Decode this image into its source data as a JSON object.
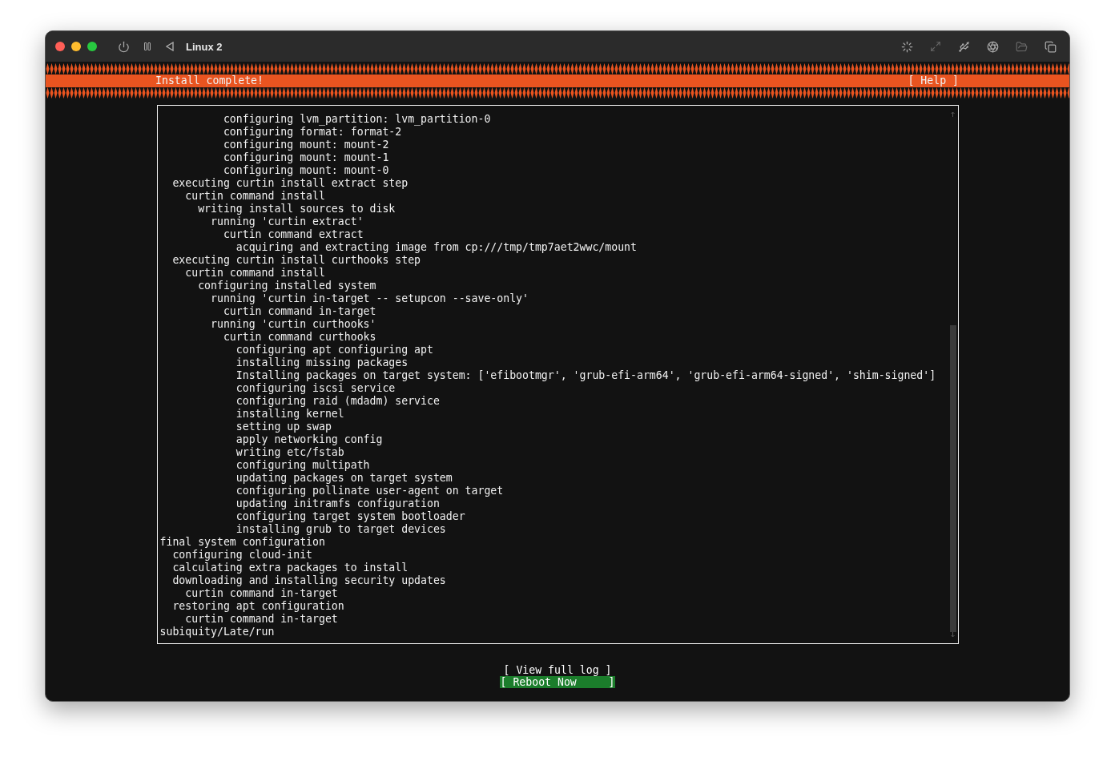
{
  "window": {
    "title": "Linux 2"
  },
  "header": {
    "title": "Install complete!",
    "help": "[ Help ]"
  },
  "log": {
    "lines": [
      "          configuring lvm_partition: lvm_partition-0",
      "          configuring format: format-2",
      "          configuring mount: mount-2",
      "          configuring mount: mount-1",
      "          configuring mount: mount-0",
      "  executing curtin install extract step",
      "    curtin command install",
      "      writing install sources to disk",
      "        running 'curtin extract'",
      "          curtin command extract",
      "            acquiring and extracting image from cp:///tmp/tmp7aet2wwc/mount",
      "  executing curtin install curthooks step",
      "    curtin command install",
      "      configuring installed system",
      "        running 'curtin in-target -- setupcon --save-only'",
      "          curtin command in-target",
      "        running 'curtin curthooks'",
      "          curtin command curthooks",
      "            configuring apt configuring apt",
      "            installing missing packages",
      "            Installing packages on target system: ['efibootmgr', 'grub-efi-arm64', 'grub-efi-arm64-signed', 'shim-signed']",
      "            configuring iscsi service",
      "            configuring raid (mdadm) service",
      "            installing kernel",
      "            setting up swap",
      "            apply networking config",
      "            writing etc/fstab",
      "            configuring multipath",
      "            updating packages on target system",
      "            configuring pollinate user-agent on target",
      "            updating initramfs configuration",
      "            configuring target system bootloader",
      "            installing grub to target devices",
      "final system configuration",
      "  configuring cloud-init",
      "  calculating extra packages to install",
      "  downloading and installing security updates",
      "    curtin command in-target",
      "  restoring apt configuration",
      "    curtin command in-target",
      "subiquity/Late/run"
    ]
  },
  "buttons": [
    {
      "label": "[ View full log ]",
      "selected": false
    },
    {
      "label": "[ Reboot Now     ]",
      "selected": true
    }
  ]
}
